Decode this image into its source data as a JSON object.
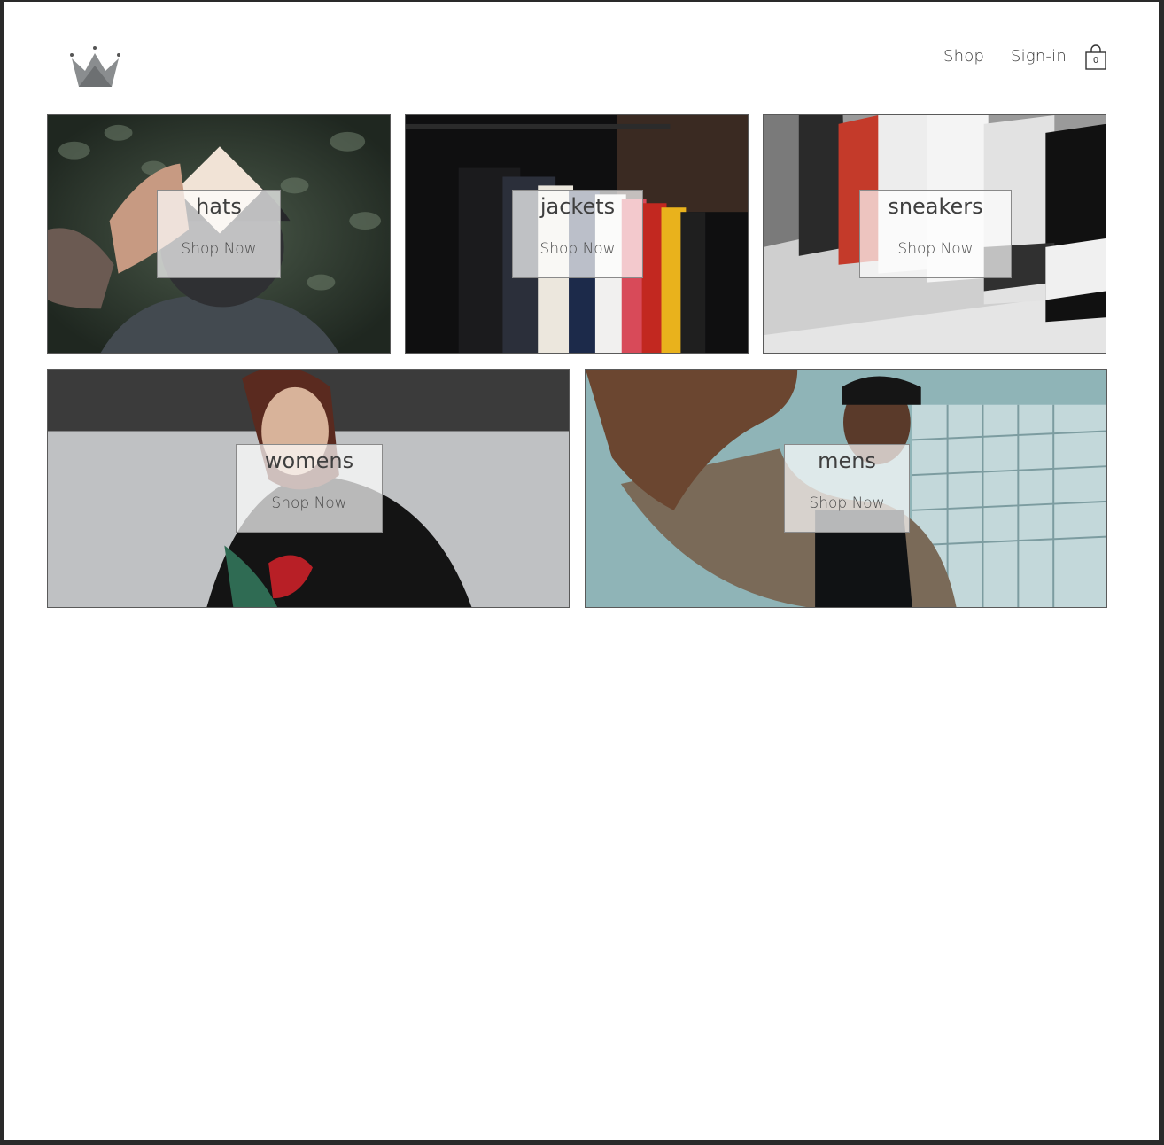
{
  "header": {
    "logo_icon": "crown-logo-icon",
    "nav": {
      "shop_label": "Shop",
      "signin_label": "Sign-in"
    },
    "cart": {
      "icon": "shopping-bag-icon",
      "count": "0"
    }
  },
  "directory": {
    "cta_label": "Shop Now",
    "tiles": [
      {
        "title": "hats",
        "cta": "Shop Now",
        "image": "person-wearing-cap-photo"
      },
      {
        "title": "jackets",
        "cta": "Shop Now",
        "image": "clothing-rack-photo"
      },
      {
        "title": "sneakers",
        "cta": "Shop Now",
        "image": "sneakers-shelf-photo"
      },
      {
        "title": "womens",
        "cta": "Shop Now",
        "image": "woman-in-hoodie-photo"
      },
      {
        "title": "mens",
        "cta": "Shop Now",
        "image": "man-reaching-photo"
      }
    ]
  },
  "colors": {
    "background": "#ffffff",
    "frame": "#2a2a2a",
    "text": "#3f3f3f",
    "overlay": "rgba(255,255,255,0.70)"
  }
}
